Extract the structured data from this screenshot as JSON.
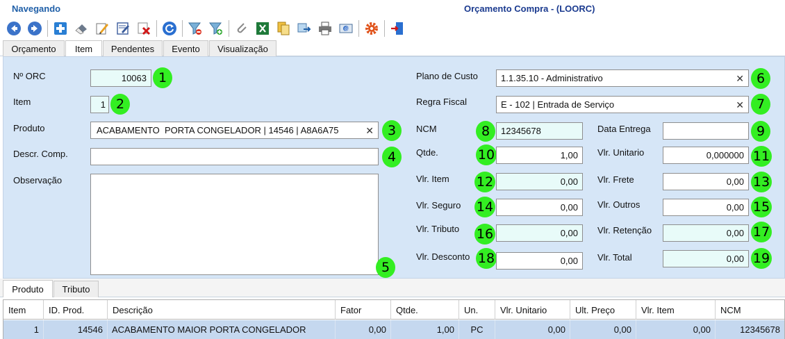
{
  "header": {
    "mode": "Navegando",
    "title": "Orçamento Compra - (LOORC)"
  },
  "toolbar": {
    "buttons": [
      "arrow-left-icon",
      "arrow-right-icon",
      "add-icon",
      "eraser-icon",
      "edit-icon",
      "edit-form-icon",
      "delete-icon",
      "refresh-icon",
      "filter-remove-icon",
      "filter-add-icon",
      "attach-icon",
      "excel-icon",
      "copy-icon",
      "transfer-icon",
      "print-icon",
      "email-icon",
      "settings-icon",
      "exit-icon"
    ]
  },
  "tabs": [
    "Orçamento",
    "Item",
    "Pendentes",
    "Evento",
    "Visualização"
  ],
  "form": {
    "orc": {
      "label": "Nº ORC",
      "value": "10063",
      "badge": "1"
    },
    "item": {
      "label": "Item",
      "value": "1",
      "badge": "2"
    },
    "produto": {
      "label": "Produto",
      "value": "ACABAMENTO  PORTA CONGELADOR | 14546 | A8A6A75",
      "badge": "3"
    },
    "descr": {
      "label": "Descr. Comp.",
      "value": "",
      "badge": "4"
    },
    "obs": {
      "label": "Observação",
      "value": "",
      "badge": "5"
    },
    "plano": {
      "label": "Plano de Custo",
      "value": "1.1.35.10 - Administrativo",
      "badge": "6"
    },
    "regra": {
      "label": "Regra Fiscal",
      "value": "E - 102 | Entrada de Serviço",
      "badge": "7"
    },
    "ncm": {
      "label": "NCM",
      "value": "12345678",
      "badge": "8"
    },
    "data_entrega": {
      "label": "Data Entrega",
      "value": "",
      "badge": "9"
    },
    "qtde": {
      "label": "Qtde.",
      "value": "1,00",
      "badge": "10"
    },
    "vlr_unitario": {
      "label": "Vlr. Unitario",
      "value": "0,000000",
      "badge": "11"
    },
    "vlr_item": {
      "label": "Vlr. Item",
      "value": "0,00",
      "badge": "12"
    },
    "vlr_frete": {
      "label": "Vlr. Frete",
      "value": "0,00",
      "badge": "13"
    },
    "vlr_seguro": {
      "label": "Vlr. Seguro",
      "value": "0,00",
      "badge": "14"
    },
    "vlr_outros": {
      "label": "Vlr. Outros",
      "value": "0,00",
      "badge": "15"
    },
    "vlr_tributo": {
      "label": "Vlr. Tributo",
      "value": "0,00",
      "badge": "16"
    },
    "vlr_retencao": {
      "label": "Vlr. Retenção",
      "value": "0,00",
      "badge": "17"
    },
    "vlr_desconto": {
      "label": "Vlr. Desconto",
      "value": "0,00",
      "badge": "18"
    },
    "vlr_total": {
      "label": "Vlr. Total",
      "value": "0,00",
      "badge": "19"
    }
  },
  "bottom_tabs": [
    "Produto",
    "Tributo"
  ],
  "grid": {
    "columns": [
      "Item",
      "ID. Prod.",
      "Descrição",
      "Fator",
      "Qtde.",
      "Un.",
      "Vlr. Unitario",
      "Ult. Preço",
      "Vlr. Item",
      "NCM"
    ],
    "rows": [
      [
        "1",
        "14546",
        "ACABAMENTO MAIOR PORTA CONGELADOR",
        "0,00",
        "1,00",
        "PC",
        "0,00",
        "0,00",
        "0,00",
        "12345678"
      ]
    ]
  },
  "colors": {
    "panel": "#d6e6f7",
    "badge": "#33ee22",
    "readonly": "#e8fbf9",
    "selected_row": "#c5d8ef",
    "title": "#1a3a8f"
  }
}
